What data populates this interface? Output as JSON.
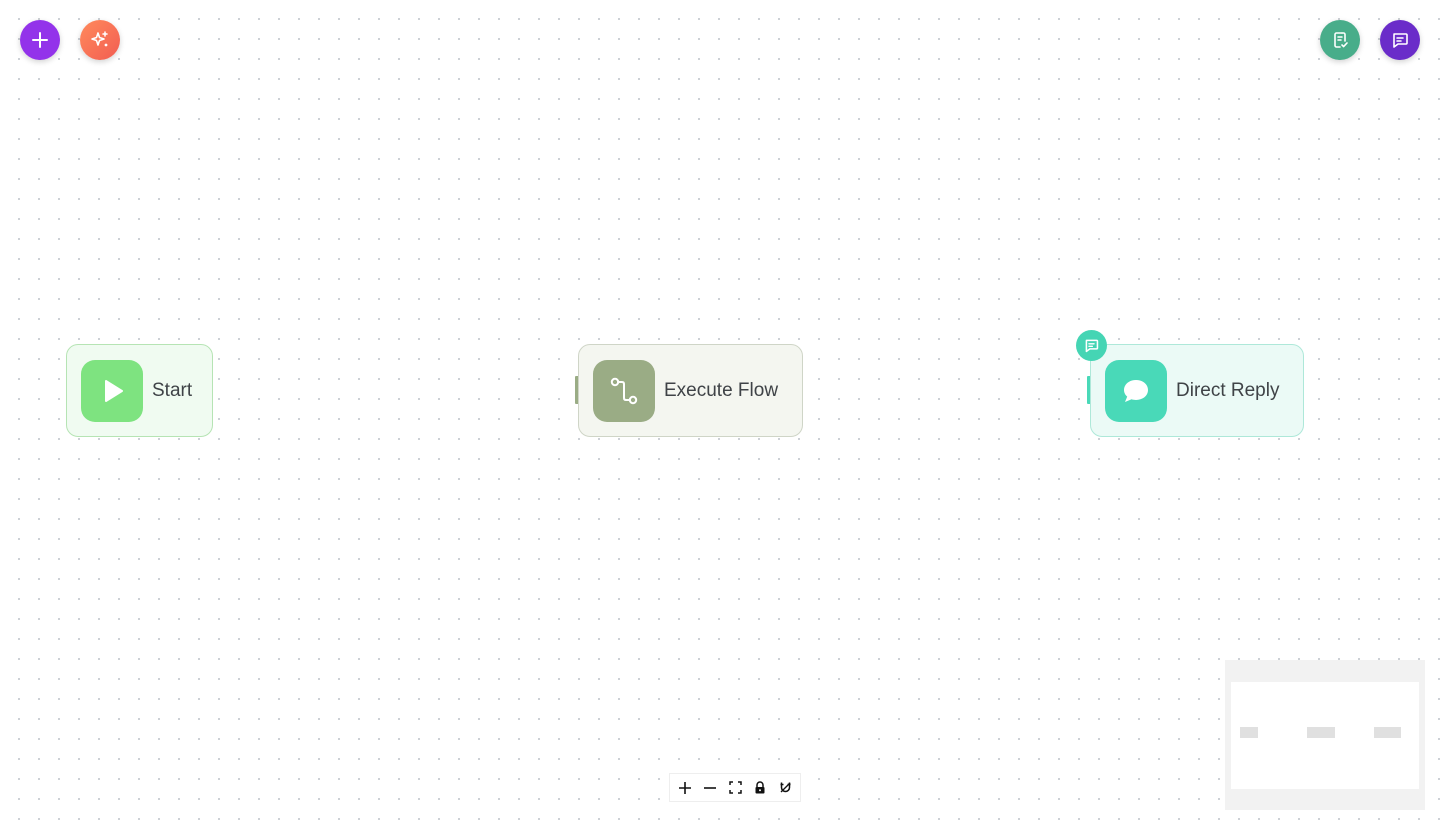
{
  "toolbar": {
    "add_icon": "plus-icon",
    "ai_icon": "sparkles-icon",
    "validate_icon": "clipboard-check-icon",
    "chat_icon": "message-square-icon",
    "colors": {
      "add": "#9333ea",
      "ai": "#f56a55",
      "validate": "#48ad8a",
      "chat": "#6a2cc9"
    }
  },
  "nodes": [
    {
      "id": "start",
      "label": "Start",
      "icon": "play-icon",
      "color": "#7ee380"
    },
    {
      "id": "execute-flow",
      "label": "Execute Flow",
      "icon": "flow-route-icon",
      "color": "#9aac85"
    },
    {
      "id": "direct-reply",
      "label": "Direct Reply",
      "icon": "chat-bubble-icon",
      "color": "#49d9b8"
    }
  ],
  "edges": [
    {
      "from": "start",
      "to": "execute-flow"
    },
    {
      "from": "execute-flow",
      "to": "direct-reply"
    }
  ],
  "controls": [
    {
      "name": "zoom-in",
      "icon": "plus-icon"
    },
    {
      "name": "zoom-out",
      "icon": "minus-icon"
    },
    {
      "name": "fit-view",
      "icon": "fit-view-icon"
    },
    {
      "name": "lock",
      "icon": "lock-icon"
    },
    {
      "name": "snap",
      "icon": "magnet-icon"
    }
  ]
}
